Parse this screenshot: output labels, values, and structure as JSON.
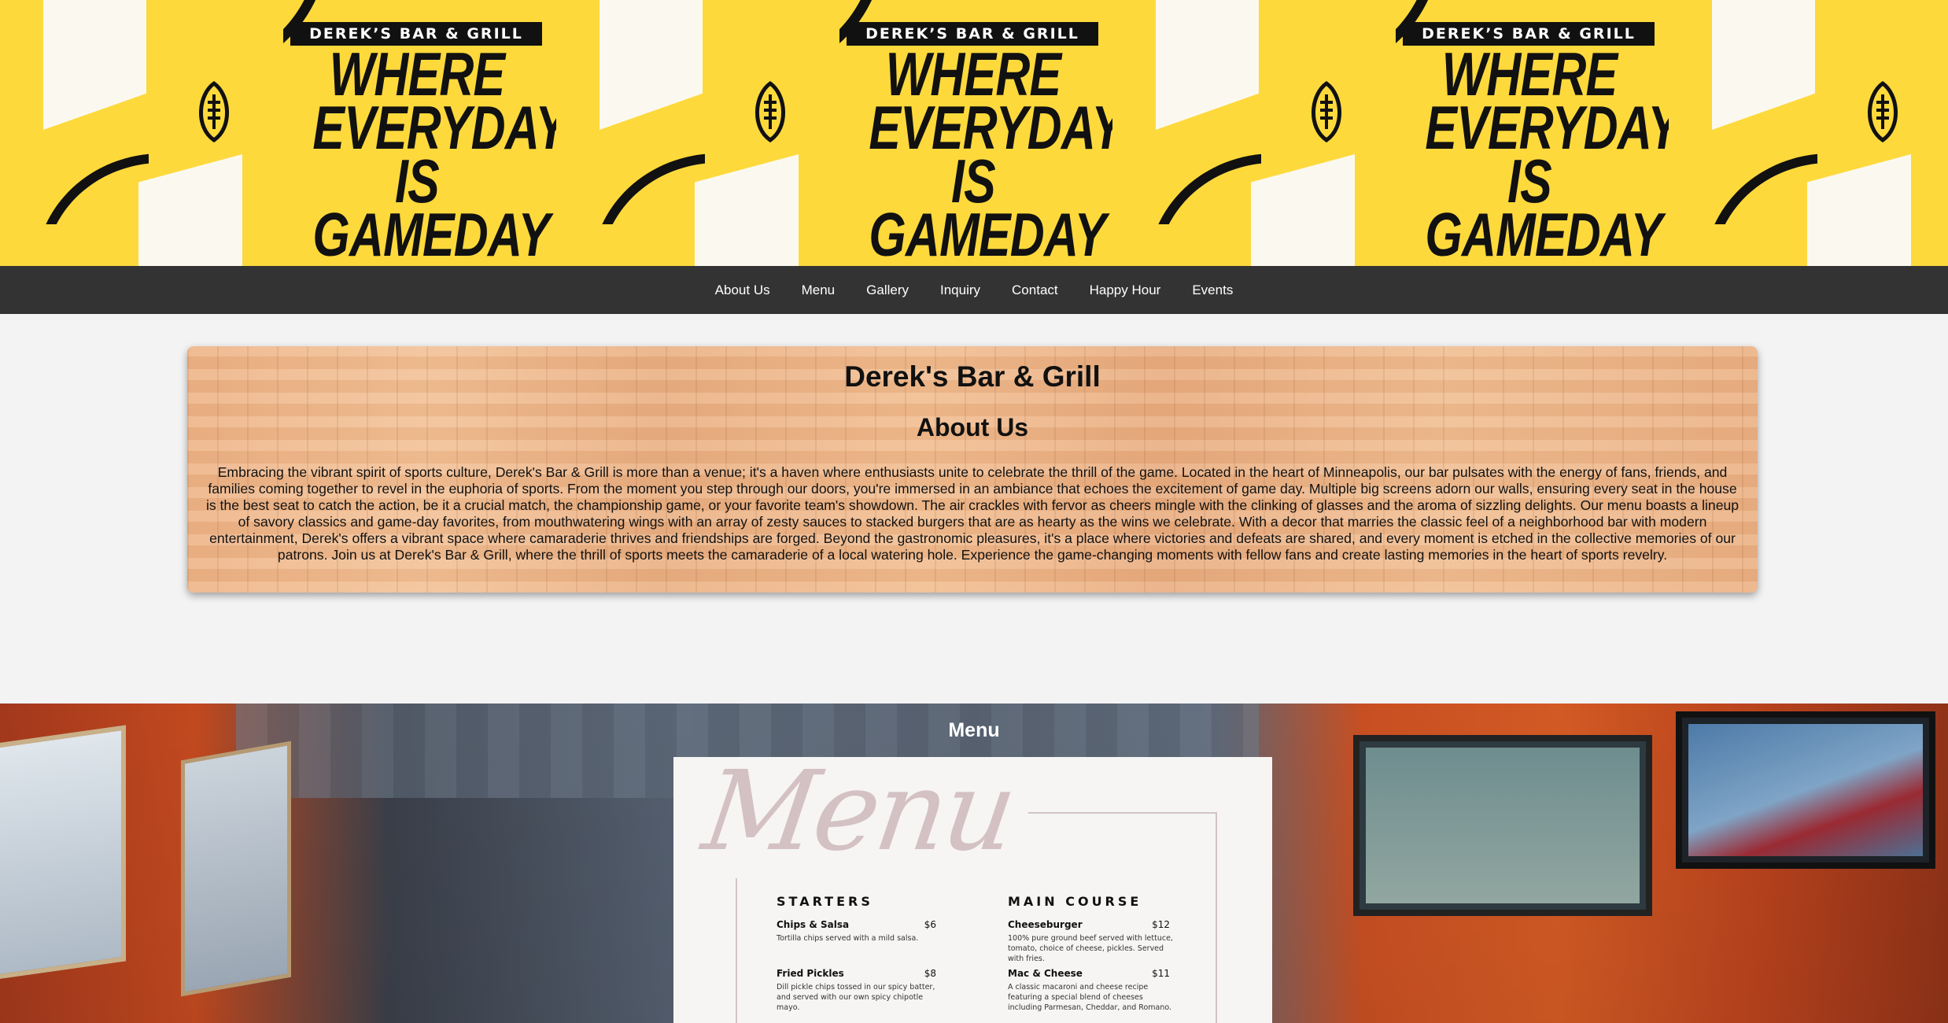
{
  "banner": {
    "brand": "DEREK’S BAR & GRILL",
    "slogan": [
      "WHERE",
      "EVERYDAY IS",
      "GAMEDAY"
    ],
    "icon": "football-icon",
    "colors": {
      "background": "#fdd93c",
      "accent": "#111111",
      "cream": "#fbf9ef"
    }
  },
  "nav": {
    "items": [
      {
        "label": "About Us"
      },
      {
        "label": "Menu"
      },
      {
        "label": "Gallery"
      },
      {
        "label": "Inquiry"
      },
      {
        "label": "Contact"
      },
      {
        "label": "Happy Hour"
      },
      {
        "label": "Events"
      }
    ]
  },
  "about": {
    "title": "Derek's Bar & Grill",
    "heading": "About Us",
    "body": "Embracing the vibrant spirit of sports culture, Derek's Bar & Grill is more than a venue; it's a haven where enthusiasts unite to celebrate the thrill of the game. Located in the heart of Minneapolis, our bar pulsates with the energy of fans, friends, and families coming together to revel in the euphoria of sports. From the moment you step through our doors, you're immersed in an ambiance that echoes the excitement of game day. Multiple big screens adorn our walls, ensuring every seat in the house is the best seat to catch the action, be it a crucial match, the championship game, or your favorite team's showdown. The air crackles with fervor as cheers mingle with the clinking of glasses and the aroma of sizzling delights. Our menu boasts a lineup of savory classics and game-day favorites, from mouthwatering wings with an array of zesty sauces to stacked burgers that are as hearty as the wins we celebrate. With a decor that marries the classic feel of a neighborhood bar with modern entertainment, Derek's offers a vibrant space where camaraderie thrives and friendships are forged. Beyond the gastronomic pleasures, it's a place where victories and defeats are shared, and every moment is etched in the collective memories of our patrons. Join us at Derek's Bar & Grill, where the thrill of sports meets the camaraderie of a local watering hole. Experience the game-changing moments with fellow fans and create lasting memories in the heart of sports revelry."
  },
  "menu": {
    "section_title": "Menu",
    "script_title": "Menu",
    "starters": {
      "heading": "STARTERS",
      "items": [
        {
          "name": "Chips & Salsa",
          "price": "$6",
          "desc": "Tortilla chips served with a mild salsa."
        },
        {
          "name": "Fried Pickles",
          "price": "$8",
          "desc": "Dill pickle chips tossed in our spicy batter, and served with our own spicy chipotle mayo."
        }
      ]
    },
    "main_course": {
      "heading": "MAIN COURSE",
      "items": [
        {
          "name": "Cheeseburger",
          "price": "$12",
          "desc": "100% pure ground beef served with lettuce, tomato, choice of cheese, pickles. Served with fries."
        },
        {
          "name": "Mac & Cheese",
          "price": "$11",
          "desc": "A classic macaroni and cheese recipe featuring a special blend of cheeses including Parmesan, Cheddar, and Romano."
        }
      ]
    }
  }
}
